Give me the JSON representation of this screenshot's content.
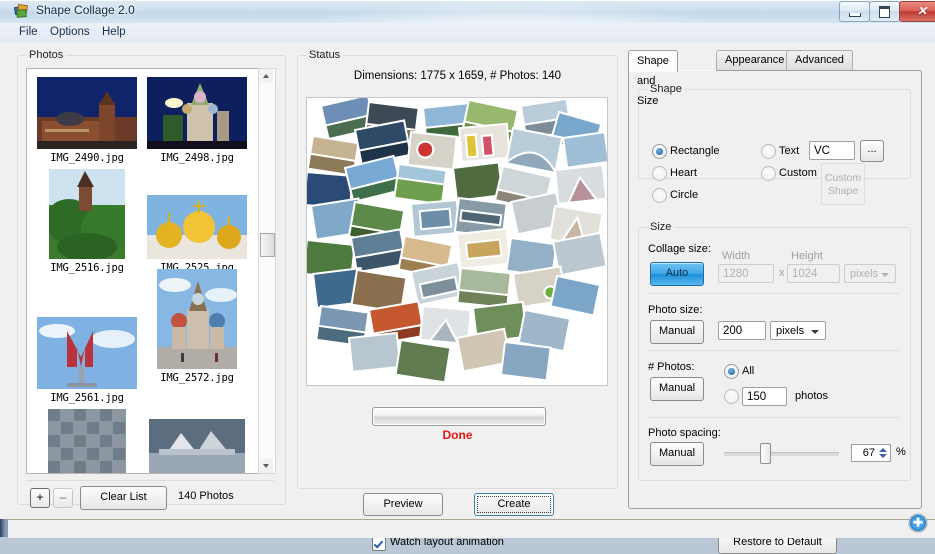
{
  "window": {
    "title": "Shape Collage 2.0",
    "app_icon": "collage-app-icon",
    "minimize_label": "–",
    "maximize_label": "□",
    "close_label": "✕"
  },
  "menubar": {
    "items": [
      {
        "label": "File"
      },
      {
        "label": "Options"
      },
      {
        "label": "Help"
      }
    ]
  },
  "photos_panel": {
    "legend": "Photos",
    "items": [
      {
        "filename": "IMG_2490.jpg",
        "alt": "kremlin-wall-night"
      },
      {
        "filename": "IMG_2498.jpg",
        "alt": "saint-basils-night"
      },
      {
        "filename": "IMG_2516.jpg",
        "alt": "tower-and-trees"
      },
      {
        "filename": "IMG_2525.jpg",
        "alt": "golden-domes-church"
      },
      {
        "filename": "IMG_2561.jpg",
        "alt": "metro-m-sign"
      },
      {
        "filename": "IMG_2572.jpg",
        "alt": "saint-basils-day"
      },
      {
        "filename": "",
        "alt": "cobblestone-partial"
      },
      {
        "filename": "",
        "alt": "monument-partial"
      }
    ],
    "add_label": "+",
    "remove_label": "–",
    "clear_label": "Clear List",
    "count_label": "140 Photos"
  },
  "status_panel": {
    "legend": "Status",
    "dimensions_text": "Dimensions: 1775 x 1659, # Photos: 140",
    "progress_percent": 100,
    "done_text": "Done",
    "done_color": "#e81313",
    "preview_button": "Preview",
    "create_button": "Create",
    "watch_checkbox_label": "Watch layout animation",
    "watch_checked": true
  },
  "settings_panel": {
    "tabs": [
      {
        "label": "Shape and Size",
        "active": true
      },
      {
        "label": "Appearance",
        "active": false
      },
      {
        "label": "Advanced",
        "active": false
      }
    ],
    "shape": {
      "legend": "Shape",
      "options": [
        {
          "label": "Rectangle",
          "selected": true
        },
        {
          "label": "Heart",
          "selected": false
        },
        {
          "label": "Circle",
          "selected": false
        },
        {
          "label": "Text",
          "selected": false
        },
        {
          "label": "Custom",
          "selected": false
        }
      ],
      "text_value": "VC",
      "browse_label": "...",
      "custom_shape_placeholder_line1": "Custom",
      "custom_shape_placeholder_line2": "Shape"
    },
    "size": {
      "legend": "Size",
      "collage_size": {
        "label": "Collage size:",
        "mode_button": "Auto",
        "width_label": "Width",
        "width_value": "1280",
        "times": "x",
        "height_label": "Height",
        "height_value": "1024",
        "units": "pixels"
      },
      "photo_size": {
        "label": "Photo size:",
        "mode_button": "Manual",
        "value": "200",
        "units": "pixels"
      },
      "num_photos": {
        "label": "# Photos:",
        "mode_button": "Manual",
        "all_label": "All",
        "all_selected": true,
        "count_value": "150",
        "count_suffix": "photos",
        "count_selected": false
      },
      "photo_spacing": {
        "label": "Photo spacing:",
        "mode_button": "Manual",
        "value": "67",
        "unit": "%",
        "slider_position_percent": 31
      }
    },
    "restore_button": "Restore to Default"
  },
  "taskbar": {
    "resize_grip_icon": "resize-grip-icon"
  },
  "colors": {
    "accent_blue": "#41a7e6",
    "status_red": "#e81313",
    "panel_bg": "#f0f0f0"
  }
}
